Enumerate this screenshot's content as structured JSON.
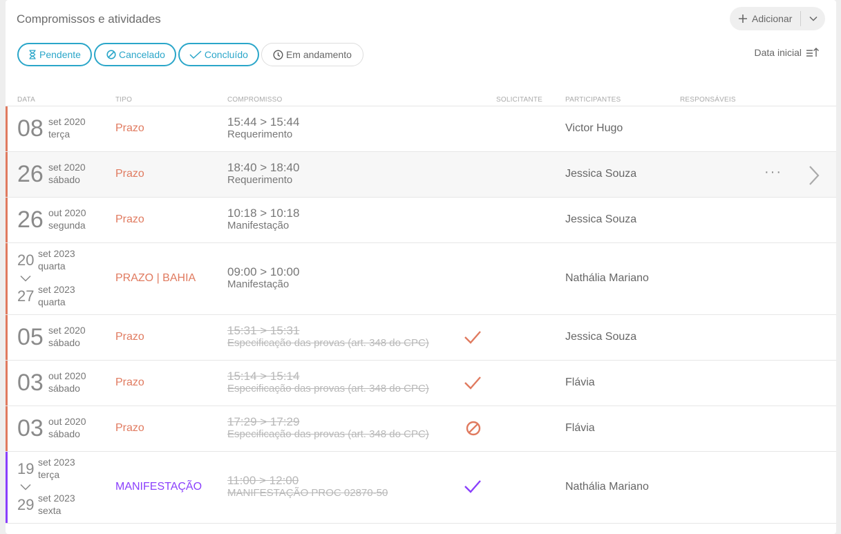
{
  "header": {
    "title": "Compromissos e atividades",
    "add_label": "Adicionar"
  },
  "filters": [
    {
      "label": "Pendente",
      "icon": "hourglass-icon"
    },
    {
      "label": "Cancelado",
      "icon": "ban-icon"
    },
    {
      "label": "Concluído",
      "icon": "check-icon"
    },
    {
      "label": "Em andamento",
      "icon": "clock-icon"
    }
  ],
  "sort": {
    "label": "Data inicial"
  },
  "columns": {
    "data": "DATA",
    "tipo": "TIPO",
    "compromisso": "COMPROMISSO",
    "solicitante": "SOLICITANTE",
    "participantes": "PARTICIPANTES",
    "responsaveis": "RESPONSÁVEIS"
  },
  "colors": {
    "accent_orange": "#e07a5f",
    "accent_purple": "#8a3ffc",
    "filter_blue": "#2aa6c9"
  },
  "rows": [
    {
      "day": "08",
      "monthyear": "set 2020",
      "weekday": "terça",
      "tipo": "Prazo",
      "time": "15:44 > 15:44",
      "name": "Requerimento",
      "participant": "Victor Hugo"
    },
    {
      "day": "26",
      "monthyear": "set 2020",
      "weekday": "sábado",
      "tipo": "Prazo",
      "time": "18:40 > 18:40",
      "name": "Requerimento",
      "participant": "Jessica Souza",
      "more": "···"
    },
    {
      "day": "26",
      "monthyear": "out 2020",
      "weekday": "segunda",
      "tipo": "Prazo",
      "time": "10:18 > 10:18",
      "name": "Manifestação",
      "participant": "Jessica Souza"
    },
    {
      "start_day": "20",
      "start_monthyear": "set 2023",
      "start_weekday": "quarta",
      "end_day": "27",
      "end_monthyear": "set 2023",
      "end_weekday": "quarta",
      "tipo": "PRAZO | BAHIA",
      "time": "09:00 > 10:00",
      "name": "Manifestação",
      "participant": "Nathália Mariano"
    },
    {
      "day": "05",
      "monthyear": "set 2020",
      "weekday": "sábado",
      "tipo": "Prazo",
      "time": "15:31 > 15:31",
      "name": "Especificação das provas (art. 348 do CPC)",
      "status": "check-icon",
      "participant": "Jessica Souza"
    },
    {
      "day": "03",
      "monthyear": "out 2020",
      "weekday": "sábado",
      "tipo": "Prazo",
      "time": "15:14 > 15:14",
      "name": "Especificação das provas (art. 348 do CPC)",
      "status": "check-icon",
      "participant": "Flávia"
    },
    {
      "day": "03",
      "monthyear": "out 2020",
      "weekday": "sábado",
      "tipo": "Prazo",
      "time": "17:29 > 17:29",
      "name": "Especificação das provas (art. 348 do CPC)",
      "status": "ban-icon",
      "participant": "Flávia"
    },
    {
      "start_day": "19",
      "start_monthyear": "set 2023",
      "start_weekday": "terça",
      "end_day": "29",
      "end_monthyear": "set 2023",
      "end_weekday": "sexta",
      "tipo": "MANIFESTAÇÃO",
      "time": "11:00 > 12:00",
      "name": "MANIFESTAÇÃO PROC 02870-50",
      "status": "check-icon",
      "participant": "Nathália Mariano"
    }
  ]
}
